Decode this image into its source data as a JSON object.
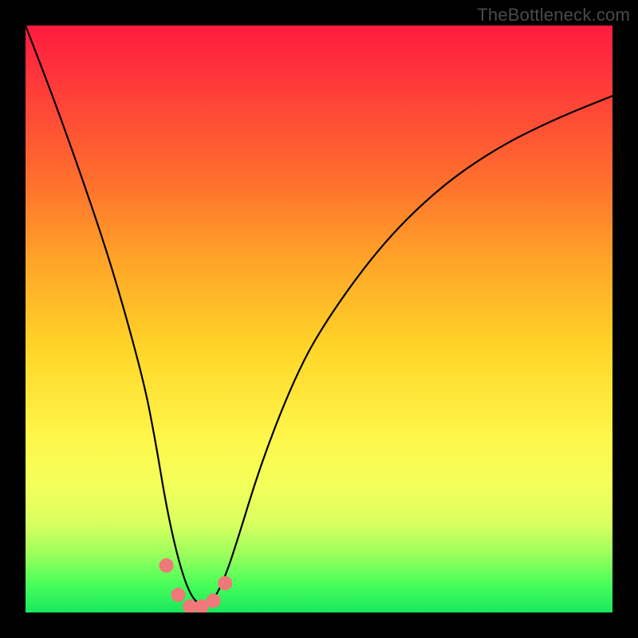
{
  "watermark": "TheBottleneck.com",
  "chart_data": {
    "type": "line",
    "title": "",
    "xlabel": "",
    "ylabel": "",
    "xlim": [
      0,
      100
    ],
    "ylim": [
      0,
      100
    ],
    "series": [
      {
        "name": "bottleneck-curve",
        "x": [
          0,
          5,
          10,
          15,
          20,
          22,
          24,
          26,
          28,
          30,
          32,
          34,
          36,
          40,
          45,
          50,
          60,
          70,
          80,
          90,
          100
        ],
        "values": [
          100,
          87,
          73,
          58,
          40,
          30,
          18,
          9,
          3,
          1,
          2,
          6,
          12,
          25,
          38,
          48,
          62,
          72,
          79,
          84,
          88
        ]
      }
    ],
    "markers": {
      "name": "bottleneck-markers",
      "x": [
        24,
        26,
        28,
        30,
        32,
        34
      ],
      "values": [
        8,
        3,
        1,
        1,
        2,
        5
      ]
    },
    "background_gradient": {
      "top": "#ff1a3f",
      "bottom": "#17e85d"
    }
  }
}
